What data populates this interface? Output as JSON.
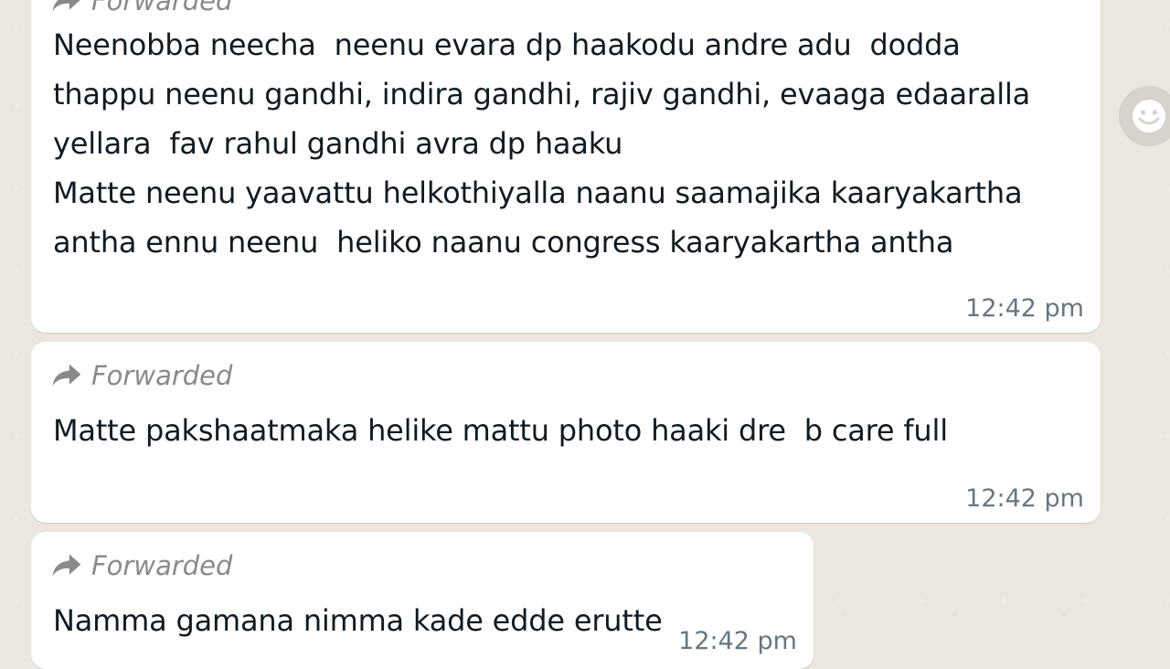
{
  "messages": [
    {
      "forwarded_label": "Forwarded",
      "lines": [
        "Neenobba neecha  neenu evara dp haakodu andre adu  dodda",
        "thappu neenu gandhi, indira gandhi, rajiv gandhi, evaaga edaaralla",
        "yellara  fav rahul gandhi avra dp haaku",
        "Matte neenu yaavattu helkothiyalla naanu saamajika kaaryakartha",
        "antha ennu neenu  heliko naanu congress kaaryakartha antha"
      ],
      "time": "12:42 pm"
    },
    {
      "forwarded_label": "Forwarded",
      "lines": [
        "Matte pakshaatmaka helike mattu photo haaki dre  b care full"
      ],
      "time": "12:42 pm"
    },
    {
      "forwarded_label": "Forwarded",
      "lines": [
        "Namma gamana nimma kade edde erutte"
      ],
      "time": "12:42 pm"
    }
  ],
  "icons": {
    "forward": "forward-arrow-icon",
    "emoji": "emoji-smiley-icon"
  },
  "colors": {
    "background": "#ebe6df",
    "bubble": "#ffffff",
    "meta_text": "#667781",
    "forwarded_text": "#8a8a8a"
  }
}
